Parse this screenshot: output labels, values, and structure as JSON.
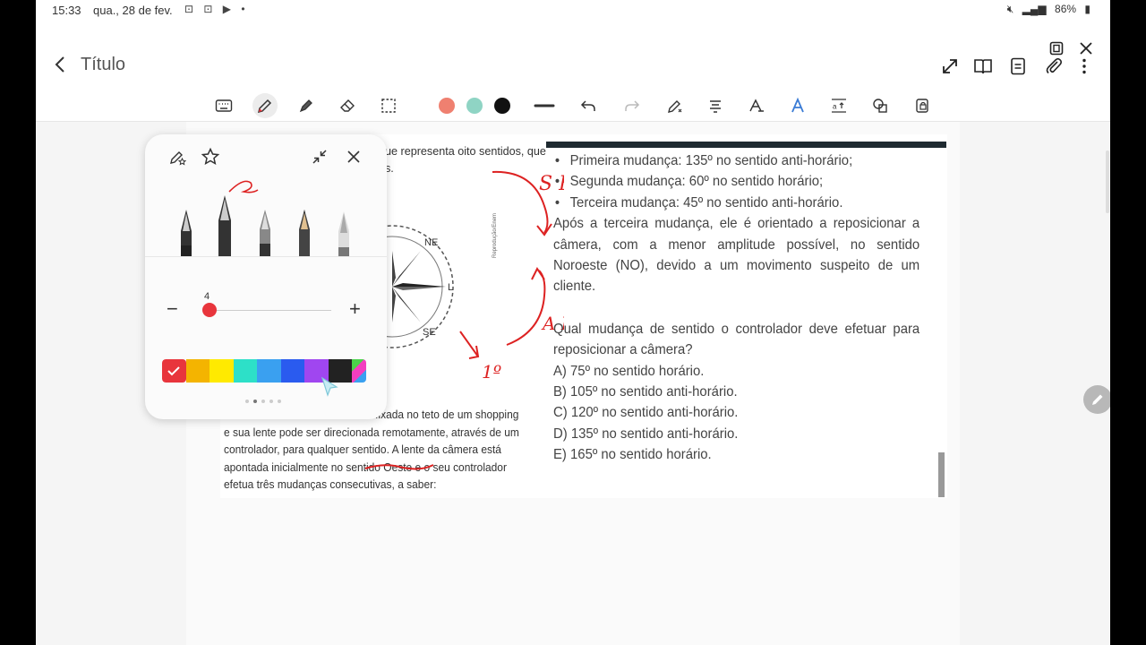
{
  "status": {
    "time": "15:33",
    "date": "qua., 28 de fev.",
    "battery": "86%"
  },
  "header": {
    "title": "Título"
  },
  "toolbar": {
    "colors": [
      "#ef8070",
      "#8fd4c4",
      "#111111"
    ]
  },
  "pen_panel": {
    "size_value": "4",
    "palette": [
      "#f4b400",
      "#ffea00",
      "#2de0c8",
      "#3aa0f0",
      "#2a5bef",
      "#a046f0",
      "#222222",
      "#49d34a"
    ]
  },
  "document": {
    "top_snippet": [
      "ue representa oito sentidos, que",
      "s."
    ],
    "bullets": [
      "Primeira mudança: 135º no sentido anti-horário;",
      "Segunda mudança: 60º no sentido horário;",
      "Terceira mudança: 45º no sentido anti-horário."
    ],
    "paragraph": "Após a terceira mudança, ele é orientado a reposicionar a câmera, com a menor amplitude possível, no sentido Noroeste (NO), devido a um movimento suspeito de um cliente.",
    "question": "Qual mudança de sentido o controlador deve efetuar para reposicionar a câmera?",
    "options": [
      "A) 75º no sentido horário.",
      "B) 105º no sentido anti-horário.",
      "C) 120º no sentido anti-horário.",
      "D) 135º no sentido anti-horário.",
      "E) 165º no sentido horário."
    ],
    "left_lines": [
      "fixada no teto de um shopping",
      "e sua lente pode ser direcionada remotamente, através de um",
      "controlador, para qualquer sentido. A lente da câmera está",
      "apontada inicialmente no sentido Oeste e o seu controlador",
      "efetua três mudanças consecutivas, a saber:"
    ],
    "compass": {
      "ne": "NE",
      "l": "L",
      "se": "SE",
      "credit": "Reprodução/Enem"
    },
    "annotations": {
      "sh": "S H",
      "ah": "A H",
      "first": "1º"
    }
  }
}
